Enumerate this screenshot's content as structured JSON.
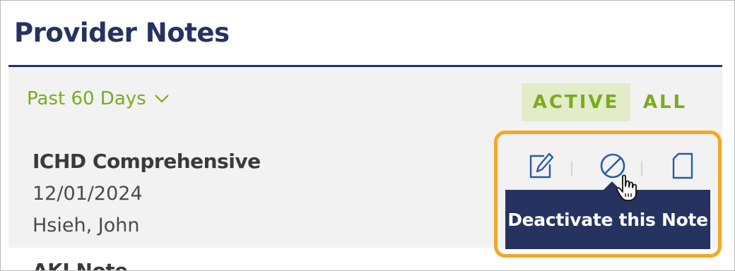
{
  "header": {
    "title": "Provider Notes"
  },
  "filter": {
    "period_label": "Past 60 Days"
  },
  "tabs": [
    {
      "label": "ACTIVE",
      "selected": true
    },
    {
      "label": "ALL",
      "selected": false
    }
  ],
  "notes": [
    {
      "title": "ICHD Comprehensive",
      "date": "12/01/2024",
      "author": "Hsieh, John"
    },
    {
      "title": "AKI Note"
    }
  ],
  "actions": {
    "icons": [
      "edit-note-icon",
      "deactivate-icon",
      "document-icon"
    ],
    "tooltip": "Deactivate this Note"
  },
  "colors": {
    "brand_navy": "#26325f",
    "accent_green": "#7bab1c",
    "active_tab_bg": "#e2ecc9",
    "highlight_orange": "#f5a627"
  }
}
